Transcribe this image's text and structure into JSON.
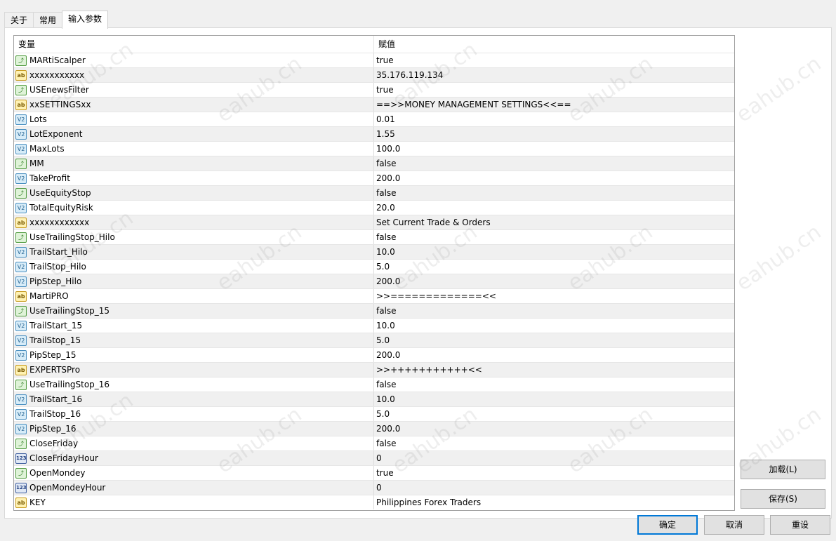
{
  "tabs": [
    "关于",
    "常用",
    "输入参数"
  ],
  "columns": {
    "variable": "变量",
    "value": "赋值"
  },
  "params": [
    {
      "type": "bool",
      "name": "MARtiScalper",
      "value": "true"
    },
    {
      "type": "str",
      "name": "xxxxxxxxxxx",
      "value": "35.176.119.134"
    },
    {
      "type": "bool",
      "name": "USEnewsFilter",
      "value": "true"
    },
    {
      "type": "str",
      "name": "xxSETTINGSxx",
      "value": "==>>MONEY MANAGEMENT SETTINGS<<=="
    },
    {
      "type": "dbl",
      "name": "Lots",
      "value": "0.01"
    },
    {
      "type": "dbl",
      "name": "LotExponent",
      "value": "1.55"
    },
    {
      "type": "dbl",
      "name": "MaxLots",
      "value": "100.0"
    },
    {
      "type": "bool",
      "name": "MM",
      "value": "false"
    },
    {
      "type": "dbl",
      "name": "TakeProfit",
      "value": "200.0"
    },
    {
      "type": "bool",
      "name": "UseEquityStop",
      "value": "false"
    },
    {
      "type": "dbl",
      "name": "TotalEquityRisk",
      "value": "20.0"
    },
    {
      "type": "str",
      "name": "xxxxxxxxxxxx",
      "value": "Set Current Trade & Orders"
    },
    {
      "type": "bool",
      "name": "UseTrailingStop_Hilo",
      "value": "false"
    },
    {
      "type": "dbl",
      "name": "TrailStart_Hilo",
      "value": "10.0"
    },
    {
      "type": "dbl",
      "name": "TrailStop_Hilo",
      "value": "5.0"
    },
    {
      "type": "dbl",
      "name": "PipStep_Hilo",
      "value": "200.0"
    },
    {
      "type": "str",
      "name": "MartiPRO",
      "value": ">>=============<<"
    },
    {
      "type": "bool",
      "name": "UseTrailingStop_15",
      "value": "false"
    },
    {
      "type": "dbl",
      "name": "TrailStart_15",
      "value": "10.0"
    },
    {
      "type": "dbl",
      "name": "TrailStop_15",
      "value": "5.0"
    },
    {
      "type": "dbl",
      "name": "PipStep_15",
      "value": "200.0"
    },
    {
      "type": "str",
      "name": "EXPERTSPro",
      "value": ">>+++++++++++<<"
    },
    {
      "type": "bool",
      "name": "UseTrailingStop_16",
      "value": "false"
    },
    {
      "type": "dbl",
      "name": "TrailStart_16",
      "value": "10.0"
    },
    {
      "type": "dbl",
      "name": "TrailStop_16",
      "value": "5.0"
    },
    {
      "type": "dbl",
      "name": "PipStep_16",
      "value": "200.0"
    },
    {
      "type": "bool",
      "name": "CloseFriday",
      "value": "false"
    },
    {
      "type": "int",
      "name": "CloseFridayHour",
      "value": "0"
    },
    {
      "type": "bool",
      "name": "OpenMondey",
      "value": "true"
    },
    {
      "type": "int",
      "name": "OpenMondeyHour",
      "value": "0"
    },
    {
      "type": "str",
      "name": "KEY",
      "value": "Philippines Forex Traders"
    }
  ],
  "icon_glyphs": {
    "bool": "⤴",
    "str": "ab",
    "dbl": "V2",
    "int": "123"
  },
  "buttons": {
    "load": "加载(L)",
    "save": "保存(S)",
    "ok": "确定",
    "cancel": "取消",
    "reset": "重设"
  },
  "watermark": "eahub.cn"
}
